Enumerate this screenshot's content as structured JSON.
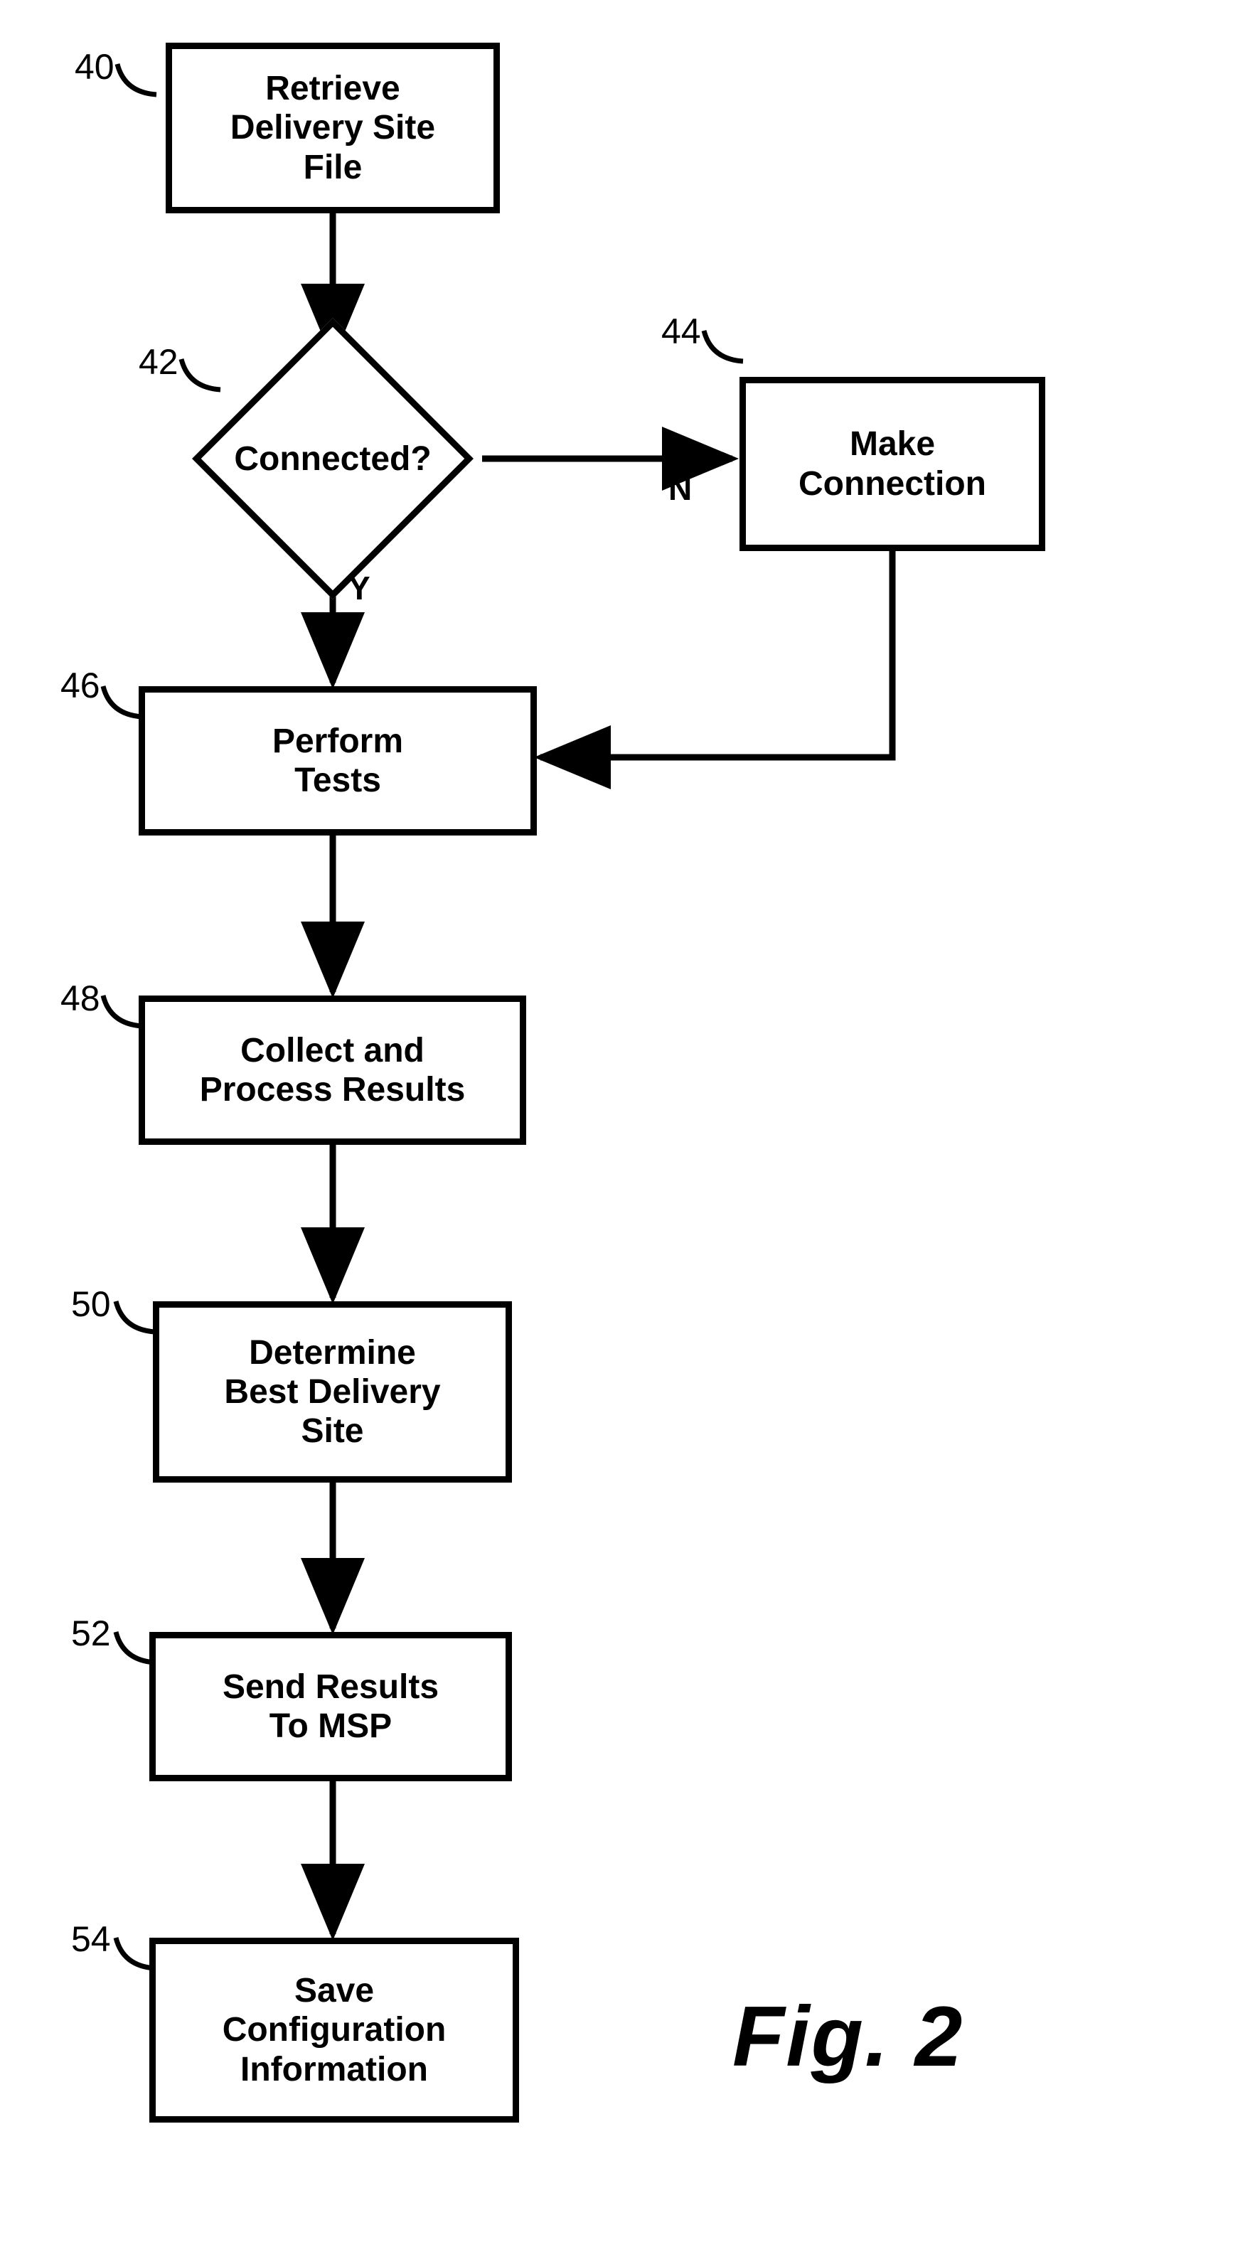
{
  "nodes": {
    "n40": {
      "ref": "40",
      "text": "Retrieve\nDelivery Site\nFile"
    },
    "n42": {
      "ref": "42",
      "text": "Connected?"
    },
    "n44": {
      "ref": "44",
      "text": "Make\nConnection"
    },
    "n46": {
      "ref": "46",
      "text": "Perform\nTests"
    },
    "n48": {
      "ref": "48",
      "text": "Collect and\nProcess Results"
    },
    "n50": {
      "ref": "50",
      "text": "Determine\nBest Delivery\nSite"
    },
    "n52": {
      "ref": "52",
      "text": "Send Results\nTo MSP"
    },
    "n54": {
      "ref": "54",
      "text": "Save\nConfiguration\nInformation"
    }
  },
  "edgeLabels": {
    "yes": "Y",
    "no": "N"
  },
  "figure": "Fig. 2",
  "chart_data": {
    "type": "flowchart",
    "nodes": [
      {
        "id": "40",
        "shape": "process",
        "label": "Retrieve Delivery Site File"
      },
      {
        "id": "42",
        "shape": "decision",
        "label": "Connected?"
      },
      {
        "id": "44",
        "shape": "process",
        "label": "Make Connection"
      },
      {
        "id": "46",
        "shape": "process",
        "label": "Perform Tests"
      },
      {
        "id": "48",
        "shape": "process",
        "label": "Collect and Process Results"
      },
      {
        "id": "50",
        "shape": "process",
        "label": "Determine Best Delivery Site"
      },
      {
        "id": "52",
        "shape": "process",
        "label": "Send Results To MSP"
      },
      {
        "id": "54",
        "shape": "process",
        "label": "Save Configuration Information"
      }
    ],
    "edges": [
      {
        "from": "40",
        "to": "42",
        "label": ""
      },
      {
        "from": "42",
        "to": "46",
        "label": "Y"
      },
      {
        "from": "42",
        "to": "44",
        "label": "N"
      },
      {
        "from": "44",
        "to": "46",
        "label": ""
      },
      {
        "from": "46",
        "to": "48",
        "label": ""
      },
      {
        "from": "48",
        "to": "50",
        "label": ""
      },
      {
        "from": "50",
        "to": "52",
        "label": ""
      },
      {
        "from": "52",
        "to": "54",
        "label": ""
      }
    ],
    "title": "Fig. 2"
  }
}
